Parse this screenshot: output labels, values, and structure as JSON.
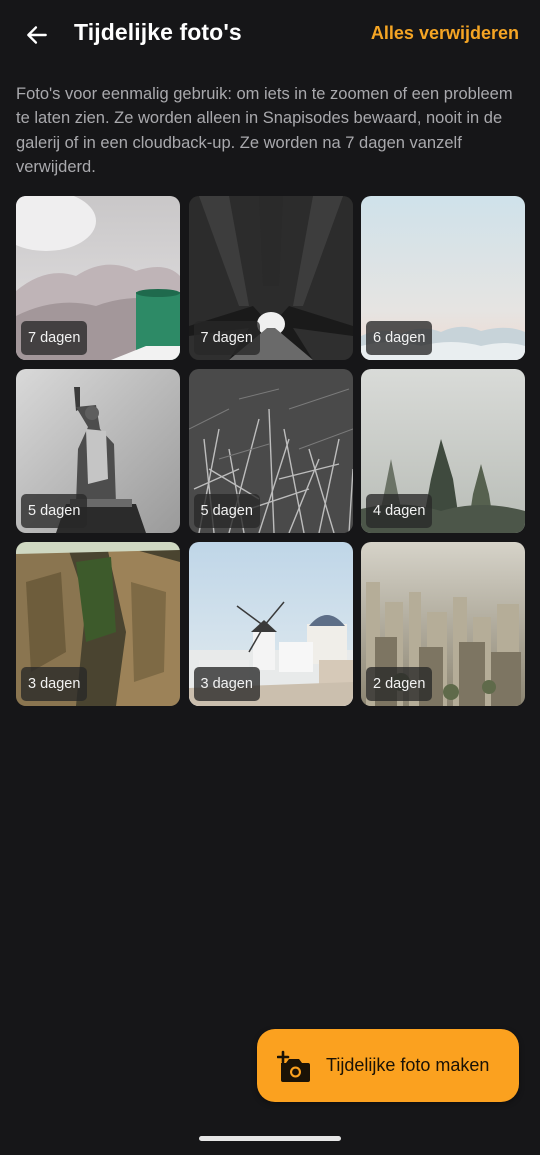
{
  "colors": {
    "background": "#161618",
    "accent": "#f5a524",
    "fab_background": "#fba11f",
    "description_text": "#a9a9ad"
  },
  "header": {
    "back_icon": "arrow-left-icon",
    "title": "Tijdelijke foto's",
    "action_label": "Alles verwijderen"
  },
  "description": "Foto's voor eenmalig gebruik: om iets in te zoomen of een probleem te laten zien. Ze worden alleen in Snapisodes bewaard, nooit in de galerij of in een cloudback-up. Ze worden na 7 dagen vanzelf verwijderd.",
  "photos": [
    {
      "subject": "mug",
      "label": "7 dagen"
    },
    {
      "subject": "tree-tunnel",
      "label": "7 dagen"
    },
    {
      "subject": "clouds",
      "label": "6 dagen"
    },
    {
      "subject": "statue-of-liberty",
      "label": "5 dagen"
    },
    {
      "subject": "grass",
      "label": "5 dagen"
    },
    {
      "subject": "foggy-forest",
      "label": "4 dagen"
    },
    {
      "subject": "rock-cliffs",
      "label": "3 dagen"
    },
    {
      "subject": "windmill-village",
      "label": "3 dagen"
    },
    {
      "subject": "city-skyline",
      "label": "2 dagen"
    }
  ],
  "fab": {
    "icon": "add-camera-icon",
    "label": "Tijdelijke foto maken"
  }
}
